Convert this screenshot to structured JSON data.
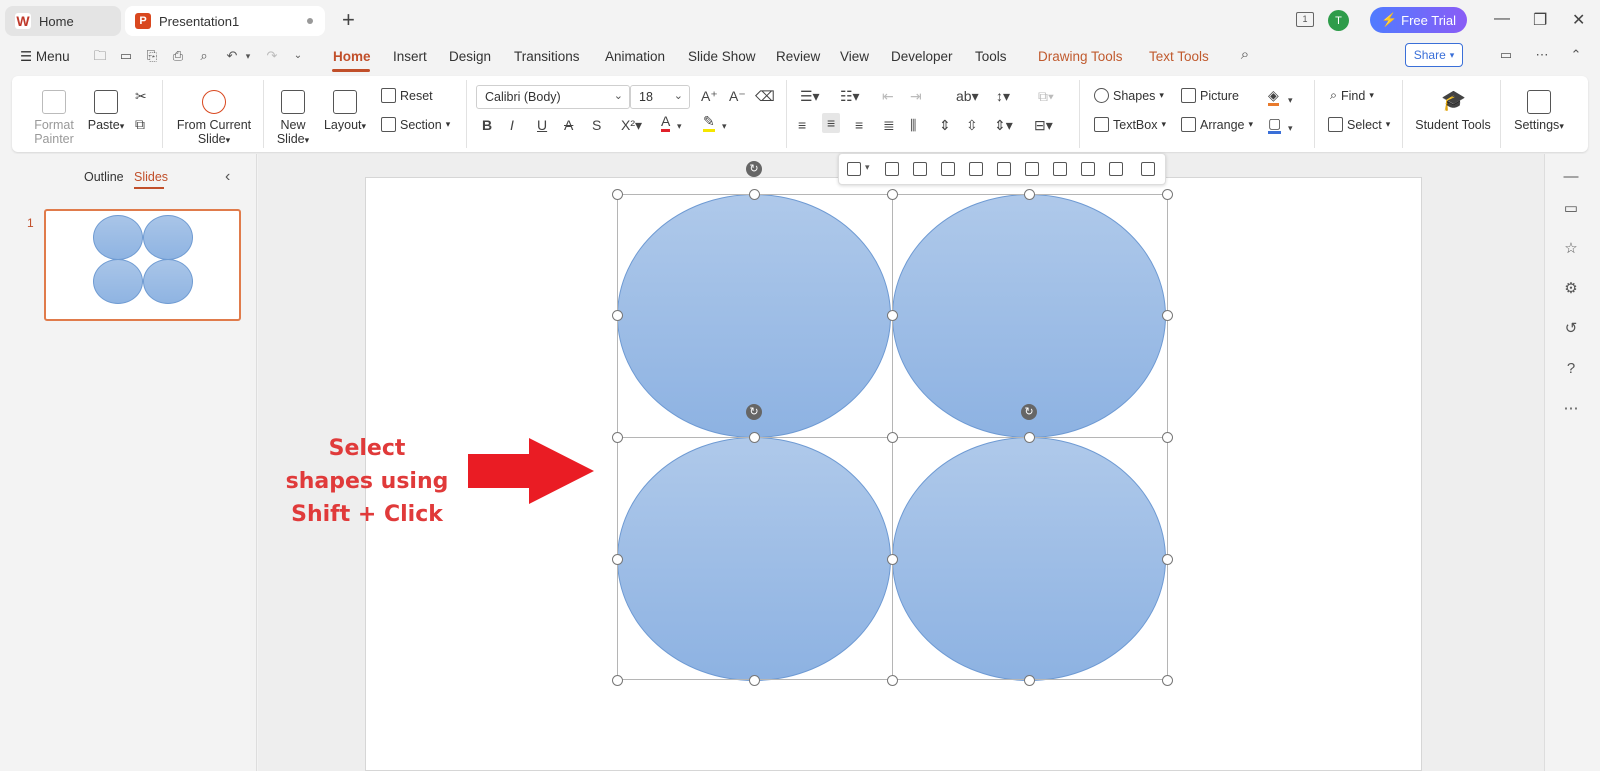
{
  "titlebar": {
    "home_tab": "Home",
    "doc_tab": "Presentation1",
    "new_tab": "+",
    "avatar_initial": "T",
    "free_trial": "Free Trial",
    "page_badge": "1"
  },
  "menubar": {
    "menu": "Menu",
    "tabs": [
      "Home",
      "Insert",
      "Design",
      "Transitions",
      "Animation",
      "Slide Show",
      "Review",
      "View",
      "Developer",
      "Tools",
      "Drawing Tools",
      "Text Tools"
    ],
    "share": "Share"
  },
  "ribbon": {
    "format_painter": "Format Painter",
    "paste": "Paste",
    "from_current_slide": "From Current Slide",
    "new_slide": "New Slide",
    "layout": "Layout",
    "reset": "Reset",
    "section": "Section",
    "font_name": "Calibri (Body)",
    "font_size": "18",
    "shapes": "Shapes",
    "picture": "Picture",
    "textbox": "TextBox",
    "arrange": "Arrange",
    "find": "Find",
    "select": "Select",
    "student_tools": "Student Tools",
    "settings": "Settings",
    "accent_font_color": "#e0202a",
    "accent_highlight": "#f5e600"
  },
  "leftpanel": {
    "outline": "Outline",
    "slides": "Slides",
    "slide_number": "1"
  },
  "slide": {
    "annotation": "Select shapes using Shift + Click",
    "annotation_color": "#e03a3a",
    "arrow_color": "#ea1c24",
    "shape_fill": "#9fbfe7"
  }
}
